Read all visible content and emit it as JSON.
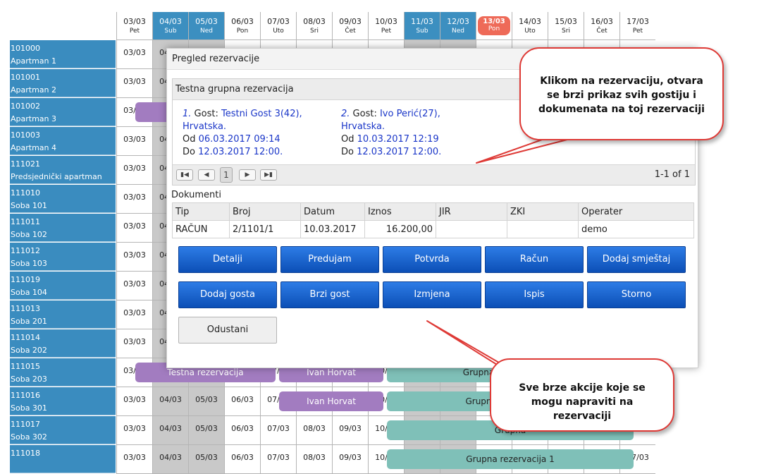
{
  "calendar": {
    "days": [
      {
        "date": "03/03",
        "wd": "Pet"
      },
      {
        "date": "04/03",
        "wd": "Sub"
      },
      {
        "date": "05/03",
        "wd": "Ned"
      },
      {
        "date": "06/03",
        "wd": "Pon"
      },
      {
        "date": "07/03",
        "wd": "Uto"
      },
      {
        "date": "08/03",
        "wd": "Sri"
      },
      {
        "date": "09/03",
        "wd": "Čet"
      },
      {
        "date": "10/03",
        "wd": "Pet"
      },
      {
        "date": "11/03",
        "wd": "Sub"
      },
      {
        "date": "12/03",
        "wd": "Ned"
      },
      {
        "date": "13/03",
        "wd": "Pon"
      },
      {
        "date": "14/03",
        "wd": "Uto"
      },
      {
        "date": "15/03",
        "wd": "Sri"
      },
      {
        "date": "16/03",
        "wd": "Čet"
      },
      {
        "date": "17/03",
        "wd": "Pet"
      }
    ],
    "rooms": [
      {
        "code": "101000",
        "name": "Apartman 1"
      },
      {
        "code": "101001",
        "name": "Apartman 2"
      },
      {
        "code": "101002",
        "name": "Apartman 3"
      },
      {
        "code": "101003",
        "name": "Apartman 4"
      },
      {
        "code": "111021",
        "name": "Predsjednički apartman"
      },
      {
        "code": "111010",
        "name": "Soba 101"
      },
      {
        "code": "111011",
        "name": "Soba 102"
      },
      {
        "code": "111012",
        "name": "Soba 103"
      },
      {
        "code": "111019",
        "name": "Soba 104"
      },
      {
        "code": "111013",
        "name": "Soba 201"
      },
      {
        "code": "111014",
        "name": "Soba 202"
      },
      {
        "code": "111015",
        "name": "Soba 203"
      },
      {
        "code": "111016",
        "name": "Soba 301"
      },
      {
        "code": "111017",
        "name": "Soba 302"
      },
      {
        "code": "111018",
        "name": ""
      }
    ],
    "bookings": {
      "testna": "Testna rezervacija",
      "ivan1": "Ivan Horvat",
      "ivan2": "Ivan Horvat",
      "grupna1": "Grupna",
      "grupna2": "Grupn",
      "grupna3": "Grupna",
      "grupna4": "Grupna rezervacija 1"
    }
  },
  "dialog": {
    "title": "Pregled rezervacije",
    "group_title": "Testna grupna rezervacija",
    "guests": [
      {
        "num": "1.",
        "label": "Gost:",
        "name": "Testni Gost 3(42),",
        "country": "Hrvatska.",
        "od_label": "Od",
        "od": "06.03.2017 09:14",
        "do_label": "Do",
        "do": "12.03.2017 12:00."
      },
      {
        "num": "2.",
        "label": "Gost:",
        "name": "Ivo Perić(27),",
        "country": "Hrvatska.",
        "od_label": "Od",
        "od": "10.03.2017 12:19",
        "do_label": "Do",
        "do": "12.03.2017 12:00."
      }
    ],
    "pager": {
      "page": "1",
      "info": "1-1 of 1"
    },
    "docs_label": "Dokumenti",
    "docs_headers": [
      "Tip",
      "Broj",
      "Datum",
      "Iznos",
      "JIR",
      "ZKI",
      "Operater"
    ],
    "docs_row": [
      "RAČUN",
      "2/1101/1",
      "10.03.2017",
      "16.200,00",
      "",
      "",
      "demo"
    ],
    "buttons": {
      "detalji": "Detalji",
      "predujam": "Predujam",
      "potvrda": "Potvrda",
      "racun": "Račun",
      "dodaj_smjestaj": "Dodaj smještaj",
      "dodaj_gosta": "Dodaj gosta",
      "brzi_gost": "Brzi gost",
      "izmjena": "Izmjena",
      "ispis": "Ispis",
      "storno": "Storno",
      "odustani": "Odustani"
    }
  },
  "callouts": {
    "top": "Klikom na rezervaciju, otvara se brzi prikaz svih gostiju i dokumenata na toj rezervaciji",
    "bottom": "Sve brze akcije koje se mogu napraviti na rezervaciji"
  },
  "colors": {
    "room_bg": "#3a8cbf",
    "weekend_head": "#3c8fc0",
    "today": "#ee6a58",
    "button": "#1565d8",
    "callout_border": "#de3a36"
  }
}
